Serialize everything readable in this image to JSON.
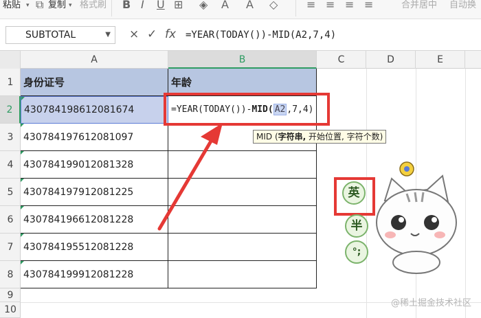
{
  "toolbar": {
    "paste": "粘贴",
    "copy": "复制",
    "format_painter": "格式刷",
    "merge_center": "合并居中",
    "auto_wrap": "自动换"
  },
  "formula_bar": {
    "name_box": "SUBTOTAL",
    "cancel_icon": "×",
    "confirm_icon": "✓",
    "fx_icon": "fx",
    "formula": "=YEAR(TODAY())-MID(A2,7,4)"
  },
  "columns": [
    "A",
    "B",
    "C",
    "D",
    "E"
  ],
  "rows": [
    "1",
    "2",
    "3",
    "4",
    "5",
    "6",
    "7",
    "8",
    "9",
    "10"
  ],
  "cells": {
    "a1": "身份证号",
    "b1": "年龄",
    "a_values": [
      "430784198612081674",
      "430784197612081097",
      "430784199012081328",
      "430784197912081225",
      "430784196612081228",
      "430784195512081228",
      "430784199912081228"
    ],
    "b2_edit": {
      "prefix": "=YEAR(TODAY())-",
      "func": "MID",
      "open": "(",
      "ref": "A2",
      "rest": ",7,4)"
    }
  },
  "tooltip": {
    "func": "MID",
    "arg1": "字符串,",
    "rest": "开始位置, 字符个数)",
    "open": "("
  },
  "stickers": [
    "英",
    "半"
  ],
  "watermark": "@稀土掘金技术社区",
  "colors": {
    "header_fill": "#b7c6e1",
    "selection": "#5b7bd5",
    "annotation_red": "#e53935",
    "active_green": "#2e9b62"
  }
}
